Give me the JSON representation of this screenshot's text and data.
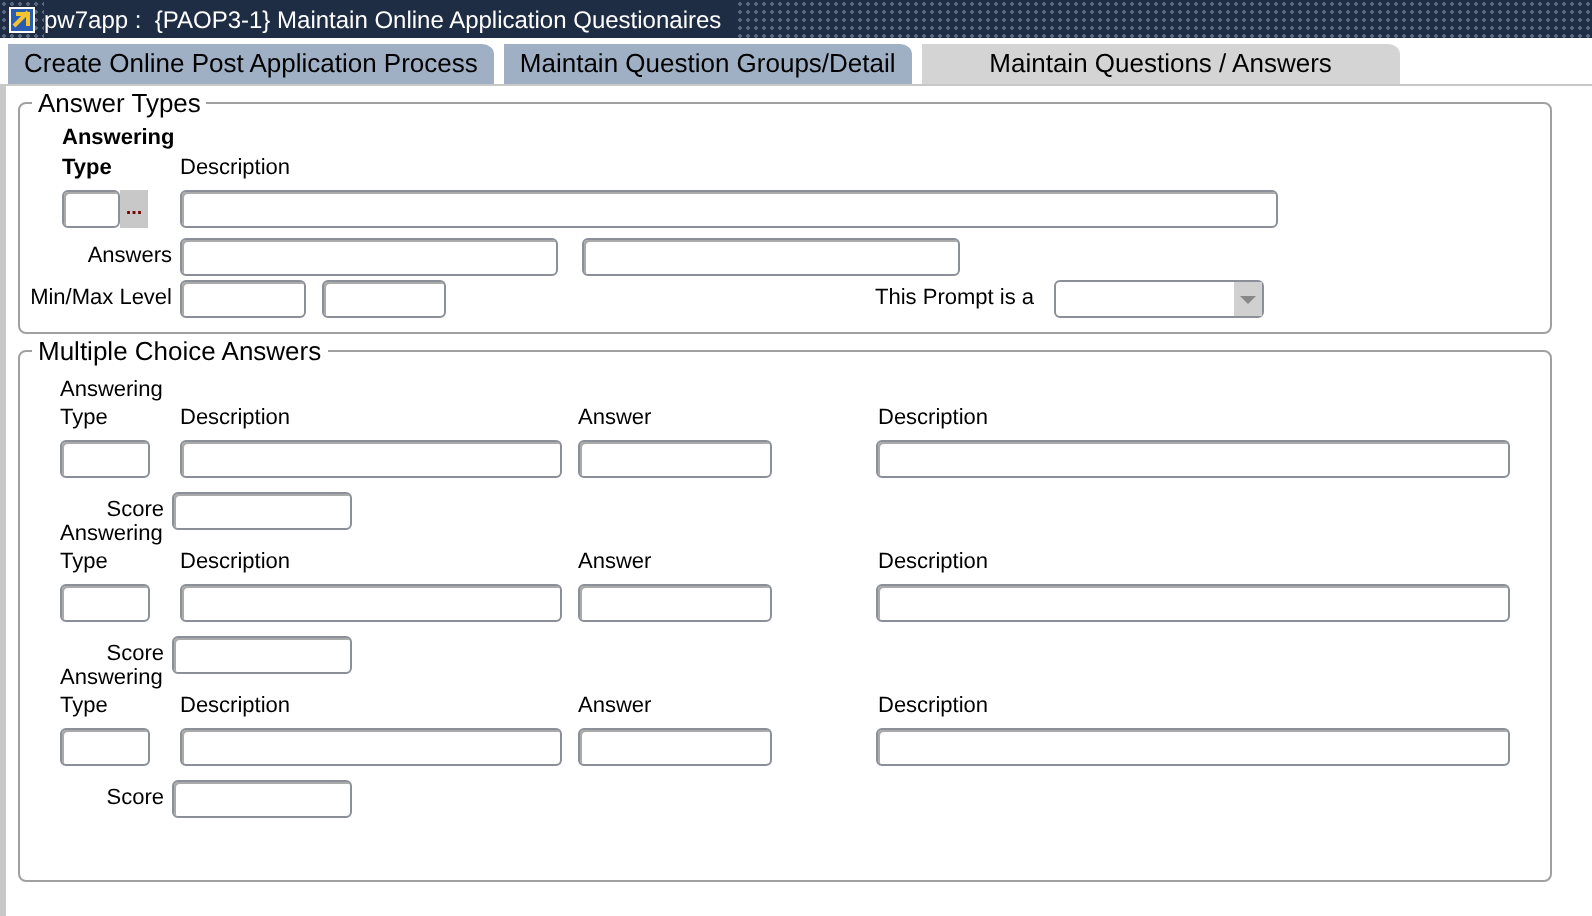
{
  "window": {
    "title": "pw7app :  {PAOP3-1} Maintain Online Application Questionaires"
  },
  "tabs": [
    {
      "label": "Create Online Post Application Process",
      "selected": false
    },
    {
      "label": "Maintain Question Groups/Detail",
      "selected": false
    },
    {
      "label": "Maintain Questions / Answers",
      "selected": true
    }
  ],
  "answer_types": {
    "legend": "Answer Types",
    "answering_label": "Answering",
    "type_label": "Type",
    "description_label": "Description",
    "lookup_button": "...",
    "answers_label": "Answers",
    "minmax_label": "Min/Max Level",
    "prompt_label": "This Prompt is a"
  },
  "multiple_choice": {
    "legend": "Multiple Choice Answers",
    "rows": [
      {
        "answering_label": "Answering",
        "type_label": "Type",
        "description_label": "Description",
        "answer_label": "Answer",
        "description_2_label": "Description",
        "score_label": "Score"
      },
      {
        "answering_label": "Answering",
        "type_label": "Type",
        "description_label": "Description",
        "answer_label": "Answer",
        "description_2_label": "Description",
        "score_label": "Score"
      },
      {
        "answering_label": "Answering",
        "type_label": "Type",
        "description_label": "Description",
        "answer_label": "Answer",
        "description_2_label": "Description",
        "score_label": "Score"
      }
    ]
  }
}
